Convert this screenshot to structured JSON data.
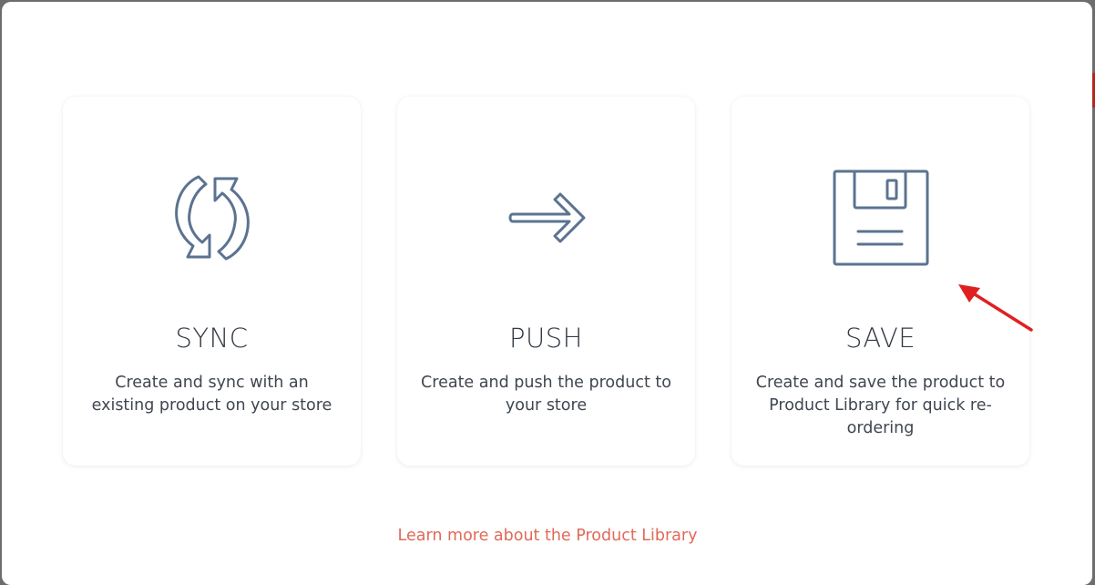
{
  "cards": [
    {
      "title": "SYNC",
      "description": "Create and sync with an existing product on your store",
      "icon": "sync-icon"
    },
    {
      "title": "PUSH",
      "description": "Create and push the product to your store",
      "icon": "arrow-right-icon"
    },
    {
      "title": "SAVE",
      "description": "Create and save the product to Product Library for quick re-ordering",
      "icon": "floppy-disk-icon"
    }
  ],
  "footer": {
    "learn_more": "Learn more about the Product Library"
  },
  "colors": {
    "icon_stroke": "#5b7390",
    "link": "#e06a57",
    "annotation_arrow": "#e02020"
  }
}
